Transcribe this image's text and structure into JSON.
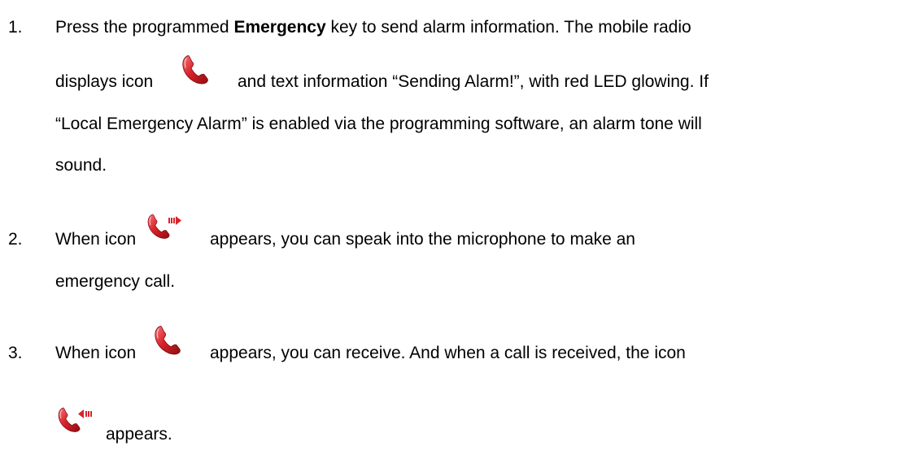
{
  "steps": [
    {
      "number": "1.",
      "line1_pre": "Press the programmed ",
      "line1_bold": "Emergency",
      "line1_post": " key to send alarm information. The mobile radio",
      "line2_pre": "displays icon",
      "line2_post": "and text information “Sending Alarm!”, with red LED glowing. If",
      "line3": "“Local Emergency Alarm” is enabled via the programming software, an alarm tone will",
      "line4": "sound.",
      "icon": "phone-icon"
    },
    {
      "number": "2.",
      "line1_pre": "When icon",
      "line1_post": "appears, you can speak into the microphone to make an",
      "line2": "emergency call.",
      "icon": "phone-transmit-icon"
    },
    {
      "number": "3.",
      "line1_pre": "When icon",
      "line1_post": "appears, you can receive. And when a call is received, the icon",
      "line2": "appears.",
      "icon_receive": "phone-icon",
      "icon_incoming": "phone-incoming-icon"
    }
  ],
  "colors": {
    "icon_red": "#d9232a",
    "icon_dark": "#9e1014",
    "icon_highlight": "#f26a6e"
  }
}
